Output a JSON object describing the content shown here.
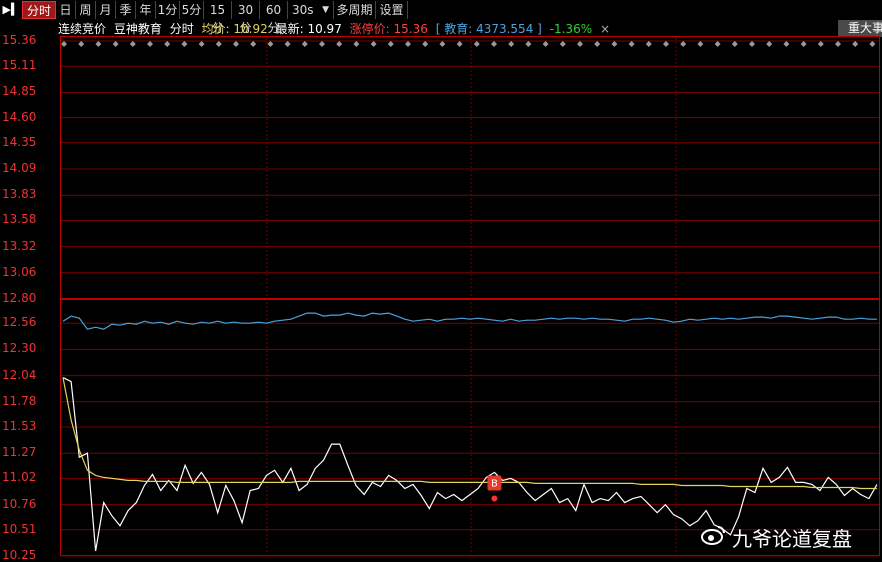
{
  "toolbar": {
    "pin_icon": "pin-icon",
    "tabs": [
      "分时",
      "日",
      "周",
      "月",
      "季",
      "年",
      "1分",
      "5分",
      "15分",
      "30分",
      "60分",
      "30s",
      "多周期",
      "设置"
    ],
    "active_tab": "分时",
    "dropdown_icon": "caret-down-icon"
  },
  "info": {
    "auction": "连续竞价",
    "stock": "豆神教育",
    "period": "分时",
    "avg_label": "均价:",
    "avg_value": "10.92",
    "last_label": "最新:",
    "last_value": "10.97",
    "limit_label": "涨停价:",
    "limit_value": "15.36",
    "index_text": "[ 教育: 4373.554 ]",
    "index_change": "-1.36%",
    "close_icon": "×",
    "event_button": "重大事"
  },
  "colors": {
    "price_line": "#ffffff",
    "avg_line": "#e6d25a",
    "index_line": "#4aa3df",
    "grid": "#7a0000",
    "axis_text": "#e33333",
    "green": "#2fd12f",
    "limit": "#ff4040"
  },
  "chart_data": {
    "type": "line",
    "yticks": [
      "15.36",
      "15.11",
      "14.85",
      "14.60",
      "14.35",
      "14.09",
      "13.83",
      "13.58",
      "13.32",
      "13.06",
      "12.80",
      "12.56",
      "12.30",
      "12.04",
      "11.78",
      "11.53",
      "11.27",
      "11.02",
      "10.76",
      "10.51",
      "10.25"
    ],
    "ylim": [
      10.25,
      15.36
    ],
    "marker": {
      "label": "B",
      "index": 53,
      "price": 10.82
    },
    "series": [
      {
        "role": "price",
        "values": [
          12.02,
          11.98,
          11.23,
          11.27,
          10.3,
          10.78,
          10.65,
          10.55,
          10.7,
          10.78,
          10.95,
          11.06,
          10.9,
          11.0,
          10.9,
          11.15,
          10.97,
          11.08,
          10.96,
          10.68,
          10.95,
          10.8,
          10.58,
          10.9,
          10.92,
          11.05,
          11.1,
          10.98,
          11.12,
          10.9,
          10.96,
          11.12,
          11.2,
          11.36,
          11.36,
          11.15,
          10.95,
          10.86,
          10.98,
          10.94,
          11.05,
          11.0,
          10.92,
          10.96,
          10.85,
          10.72,
          10.88,
          10.82,
          10.86,
          10.8,
          10.86,
          10.92,
          11.03,
          11.08,
          11.0,
          11.02,
          10.98,
          10.88,
          10.8,
          10.86,
          10.92,
          10.78,
          10.82,
          10.7,
          10.96,
          10.78,
          10.82,
          10.8,
          10.88,
          10.78,
          10.82,
          10.84,
          10.76,
          10.68,
          10.76,
          10.66,
          10.62,
          10.55,
          10.6,
          10.7,
          10.56,
          10.52,
          10.46,
          10.64,
          10.92,
          10.88,
          11.12,
          10.98,
          11.03,
          11.13,
          10.98,
          10.98,
          10.96,
          10.9,
          11.03,
          10.96,
          10.85,
          10.92,
          10.86,
          10.82,
          10.96
        ]
      },
      {
        "role": "average",
        "values": [
          12.02,
          11.6,
          11.3,
          11.1,
          11.05,
          11.03,
          11.02,
          11.01,
          11.0,
          11.0,
          10.99,
          10.99,
          10.99,
          10.99,
          10.98,
          10.98,
          10.98,
          10.98,
          10.98,
          10.98,
          10.98,
          10.98,
          10.98,
          10.98,
          10.98,
          10.98,
          10.98,
          10.98,
          10.98,
          10.99,
          10.99,
          10.99,
          10.99,
          10.99,
          10.99,
          10.99,
          10.99,
          10.99,
          10.99,
          10.99,
          10.99,
          10.99,
          10.99,
          10.99,
          10.99,
          10.98,
          10.98,
          10.98,
          10.98,
          10.98,
          10.98,
          10.98,
          10.98,
          10.98,
          10.98,
          10.98,
          10.98,
          10.98,
          10.97,
          10.97,
          10.97,
          10.97,
          10.97,
          10.97,
          10.97,
          10.97,
          10.97,
          10.97,
          10.97,
          10.97,
          10.97,
          10.96,
          10.96,
          10.96,
          10.96,
          10.96,
          10.95,
          10.95,
          10.95,
          10.95,
          10.95,
          10.95,
          10.94,
          10.94,
          10.94,
          10.94,
          10.94,
          10.94,
          10.94,
          10.94,
          10.94,
          10.94,
          10.93,
          10.93,
          10.93,
          10.93,
          10.93,
          10.93,
          10.92,
          10.92,
          10.92
        ]
      },
      {
        "role": "index",
        "values": [
          12.58,
          12.63,
          12.61,
          12.5,
          12.52,
          12.5,
          12.55,
          12.54,
          12.56,
          12.55,
          12.58,
          12.56,
          12.57,
          12.55,
          12.58,
          12.56,
          12.55,
          12.57,
          12.56,
          12.58,
          12.56,
          12.57,
          12.56,
          12.56,
          12.57,
          12.56,
          12.58,
          12.59,
          12.6,
          12.63,
          12.66,
          12.66,
          12.63,
          12.64,
          12.64,
          12.66,
          12.64,
          12.63,
          12.66,
          12.65,
          12.66,
          12.63,
          12.6,
          12.58,
          12.59,
          12.6,
          12.58,
          12.6,
          12.6,
          12.61,
          12.6,
          12.61,
          12.6,
          12.59,
          12.58,
          12.6,
          12.58,
          12.59,
          12.59,
          12.6,
          12.61,
          12.6,
          12.61,
          12.61,
          12.6,
          12.61,
          12.6,
          12.6,
          12.59,
          12.58,
          12.6,
          12.6,
          12.61,
          12.6,
          12.59,
          12.57,
          12.58,
          12.6,
          12.59,
          12.6,
          12.61,
          12.6,
          12.61,
          12.6,
          12.61,
          12.62,
          12.62,
          12.61,
          12.63,
          12.63,
          12.62,
          12.61,
          12.6,
          12.61,
          12.62,
          12.62,
          12.6,
          12.6,
          12.61,
          12.6,
          12.6
        ]
      }
    ]
  },
  "watermark": {
    "icon": "weibo-icon",
    "text": "九爷论道复盘"
  }
}
